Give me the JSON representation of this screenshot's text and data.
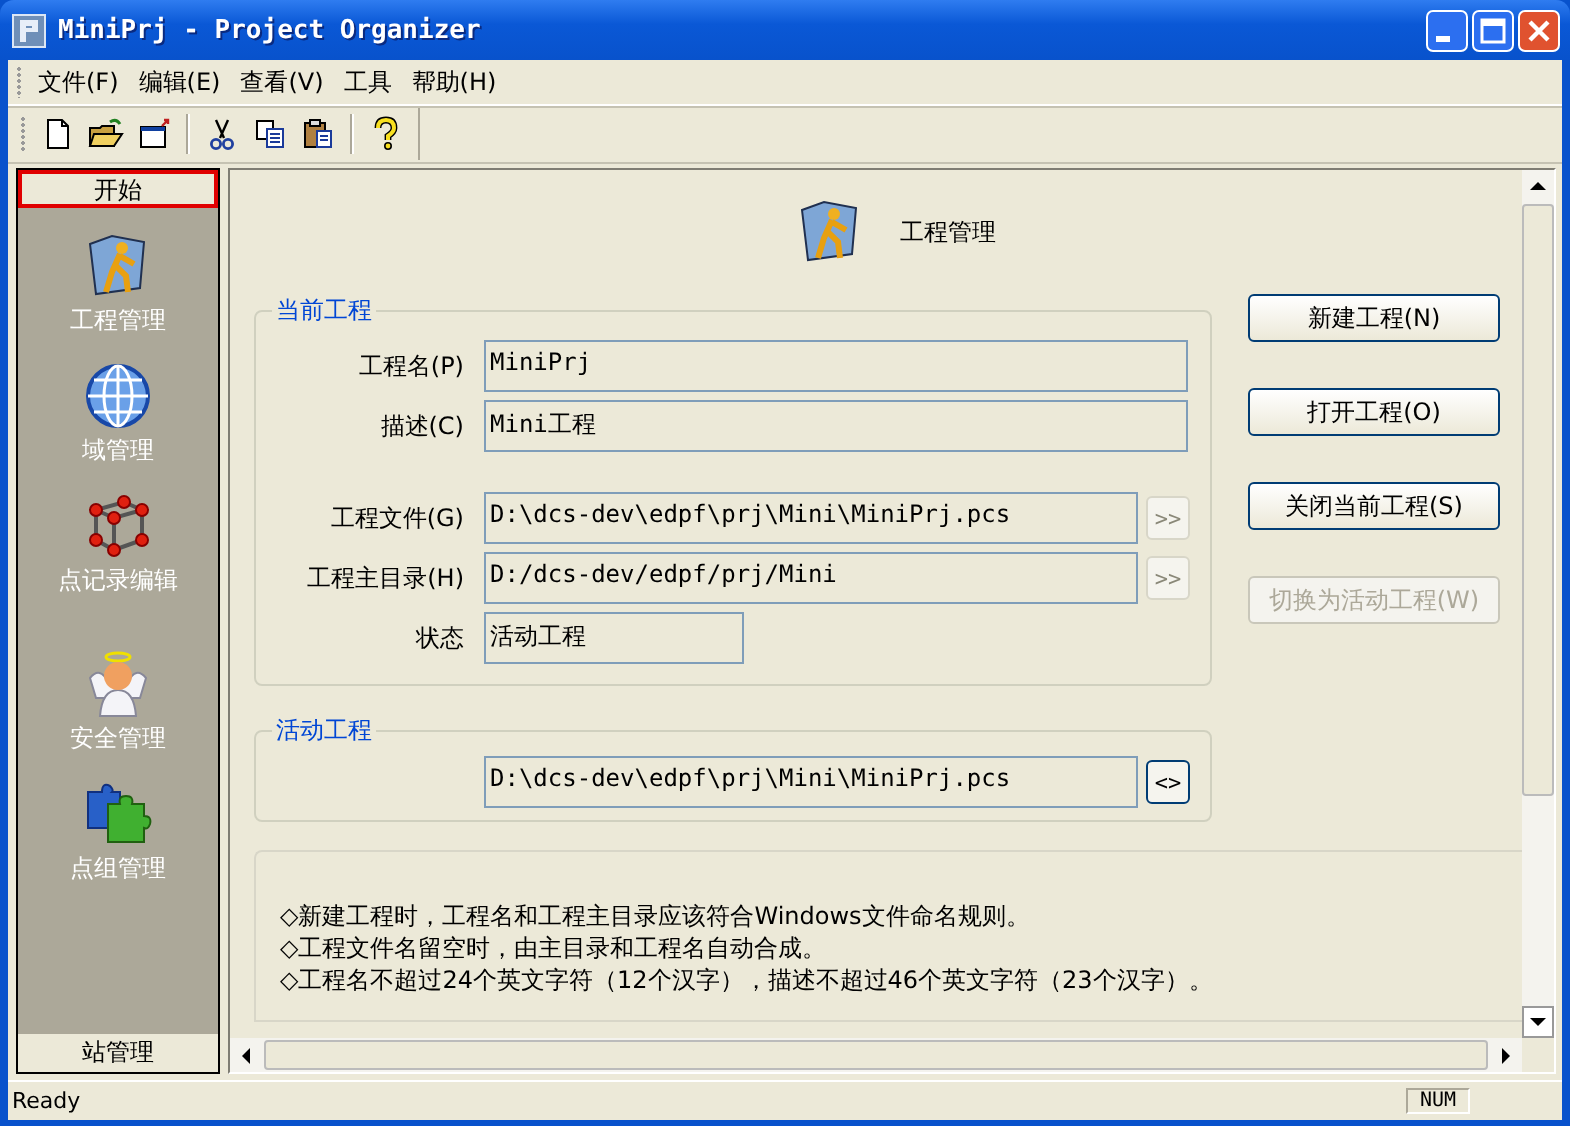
{
  "window": {
    "title": "MiniPrj - Project Organizer"
  },
  "menu": [
    "文件(F)",
    "编辑(E)",
    "查看(V)",
    "工具",
    "帮助(H)"
  ],
  "sidebar": {
    "header": {
      "label": "开始",
      "focused": true
    },
    "items": [
      {
        "label": "工程管理"
      },
      {
        "label": "域管理"
      },
      {
        "label": "点记录编辑"
      },
      {
        "label": "安全管理"
      },
      {
        "label": "点组管理"
      }
    ],
    "footer": {
      "label": "站管理",
      "focused": false
    }
  },
  "page": {
    "title": "工程管理",
    "current_project": {
      "legend": "当前工程",
      "fields": [
        {
          "label": "工程名(P)",
          "value": "MiniPrj",
          "kind": "text"
        },
        {
          "label": "描述(C)",
          "value": "Mini工程",
          "kind": "text"
        },
        {
          "label": "工程文件(G)",
          "value": "D:\\dcs-dev\\edpf\\prj\\Mini\\MiniPrj.pcs",
          "kind": "browse",
          "button": ">>",
          "disabled": true
        },
        {
          "label": "工程主目录(H)",
          "value": "D:/dcs-dev/edpf/prj/Mini",
          "kind": "browse",
          "button": ">>",
          "disabled": true
        },
        {
          "label": "状态",
          "value": "活动工程",
          "kind": "status"
        }
      ]
    },
    "active_project": {
      "legend": "活动工程",
      "value": "D:\\dcs-dev\\edpf\\prj\\Mini\\MiniPrj.pcs",
      "button": "<>",
      "disabled": false
    },
    "buttons": [
      {
        "label": "新建工程(N)",
        "disabled": false
      },
      {
        "label": "打开工程(O)",
        "disabled": false
      },
      {
        "label": "关闭当前工程(S)",
        "disabled": false
      },
      {
        "label": "切换为活动工程(W)",
        "disabled": true
      }
    ],
    "notes": [
      "◇新建工程时，工程名和工程主目录应该符合Windows文件命名规则。",
      "◇工程文件名留空时，由主目录和工程名自动合成。",
      "◇工程名不超过24个英文字符（12个汉字），描述不超过46个英文字符（23个汉字）。"
    ]
  },
  "status_bar": {
    "message": "Ready",
    "indicator": "NUM"
  }
}
